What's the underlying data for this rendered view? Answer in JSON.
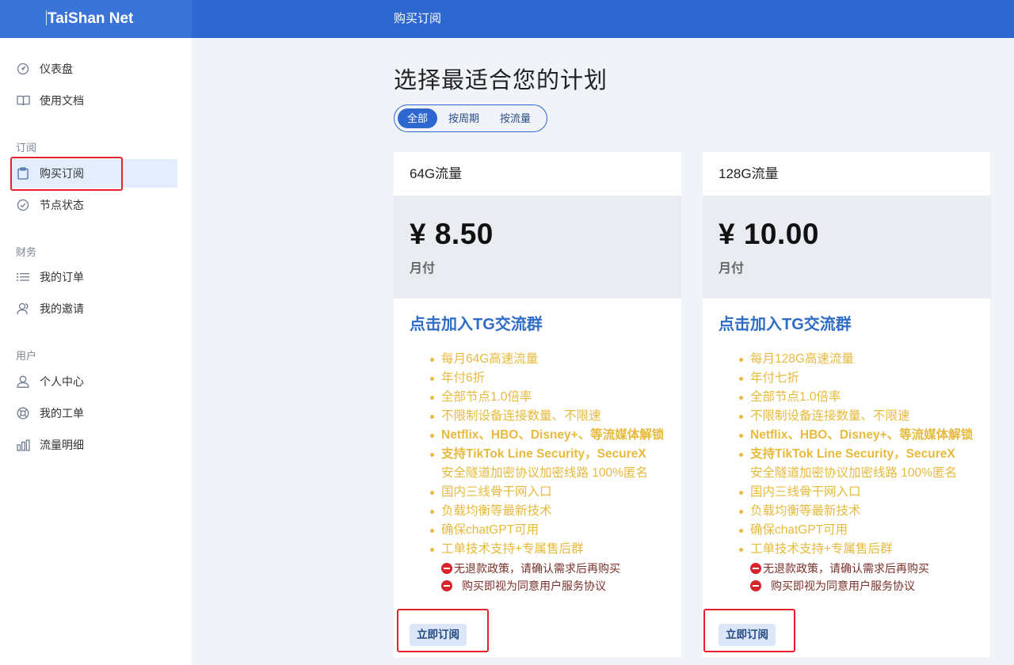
{
  "app": {
    "brand": "TaiShan Net",
    "page_title": "购买订阅"
  },
  "sidebar": {
    "items": [
      {
        "label": "仪表盘",
        "icon": "dashboard-icon"
      },
      {
        "label": "使用文档",
        "icon": "book-icon"
      },
      {
        "label": "购买订阅",
        "icon": "clipboard-icon",
        "active": true
      },
      {
        "label": "节点状态",
        "icon": "check-circle-icon"
      },
      {
        "label": "我的订单",
        "icon": "list-icon"
      },
      {
        "label": "我的邀请",
        "icon": "users-icon"
      },
      {
        "label": "个人中心",
        "icon": "user-icon"
      },
      {
        "label": "我的工单",
        "icon": "lifebuoy-icon"
      },
      {
        "label": "流量明细",
        "icon": "bar-chart-icon"
      }
    ],
    "groups": [
      "订阅",
      "财务",
      "用户"
    ]
  },
  "main": {
    "heading": "选择最适合您的计划",
    "filters": [
      "全部",
      "按周期",
      "按流量"
    ],
    "active_filter": "全部"
  },
  "plans": [
    {
      "name": "64G流量",
      "price": "¥ 8.50",
      "period": "月付",
      "tg_link": "点击加入TG交流群",
      "features": [
        "每月64G高速流量",
        "年付6折",
        "全部节点1.0倍率",
        "不限制设备连接数量、不限速",
        "Netflix、HBO、Disney+、等流媒体解锁",
        "支持TikTok Line Security，SecureX",
        "安全隧道加密协议加密线路 100%匿名",
        "国内三线骨干网入口",
        "负载均衡等最新技术",
        "确保chatGPT可用",
        "工单技术支持+专属售后群"
      ],
      "notices": [
        "无退款政策，请确认需求后再购买",
        "购买即视为同意用户服务协议"
      ],
      "button": "立即订阅"
    },
    {
      "name": "128G流量",
      "price": "¥ 10.00",
      "period": "月付",
      "tg_link": "点击加入TG交流群",
      "features": [
        "每月128G高速流量",
        "年付七折",
        "全部节点1.0倍率",
        "不限制设备连接数量、不限速",
        "Netflix、HBO、Disney+、等流媒体解锁",
        "支持TikTok Line Security，SecureX",
        "安全隧道加密协议加密线路 100%匿名",
        "国内三线骨干网入口",
        "负载均衡等最新技术",
        "确保chatGPT可用",
        "工单技术支持+专属售后群"
      ],
      "notices": [
        "无退款政策，请确认需求后再购买",
        "购买即视为同意用户服务协议"
      ],
      "button": "立即订阅"
    }
  ],
  "colors": {
    "primary": "#2d67cf",
    "feature": "#e7ba3d",
    "link": "#2f6cc6",
    "highlight": "#e5222b"
  }
}
